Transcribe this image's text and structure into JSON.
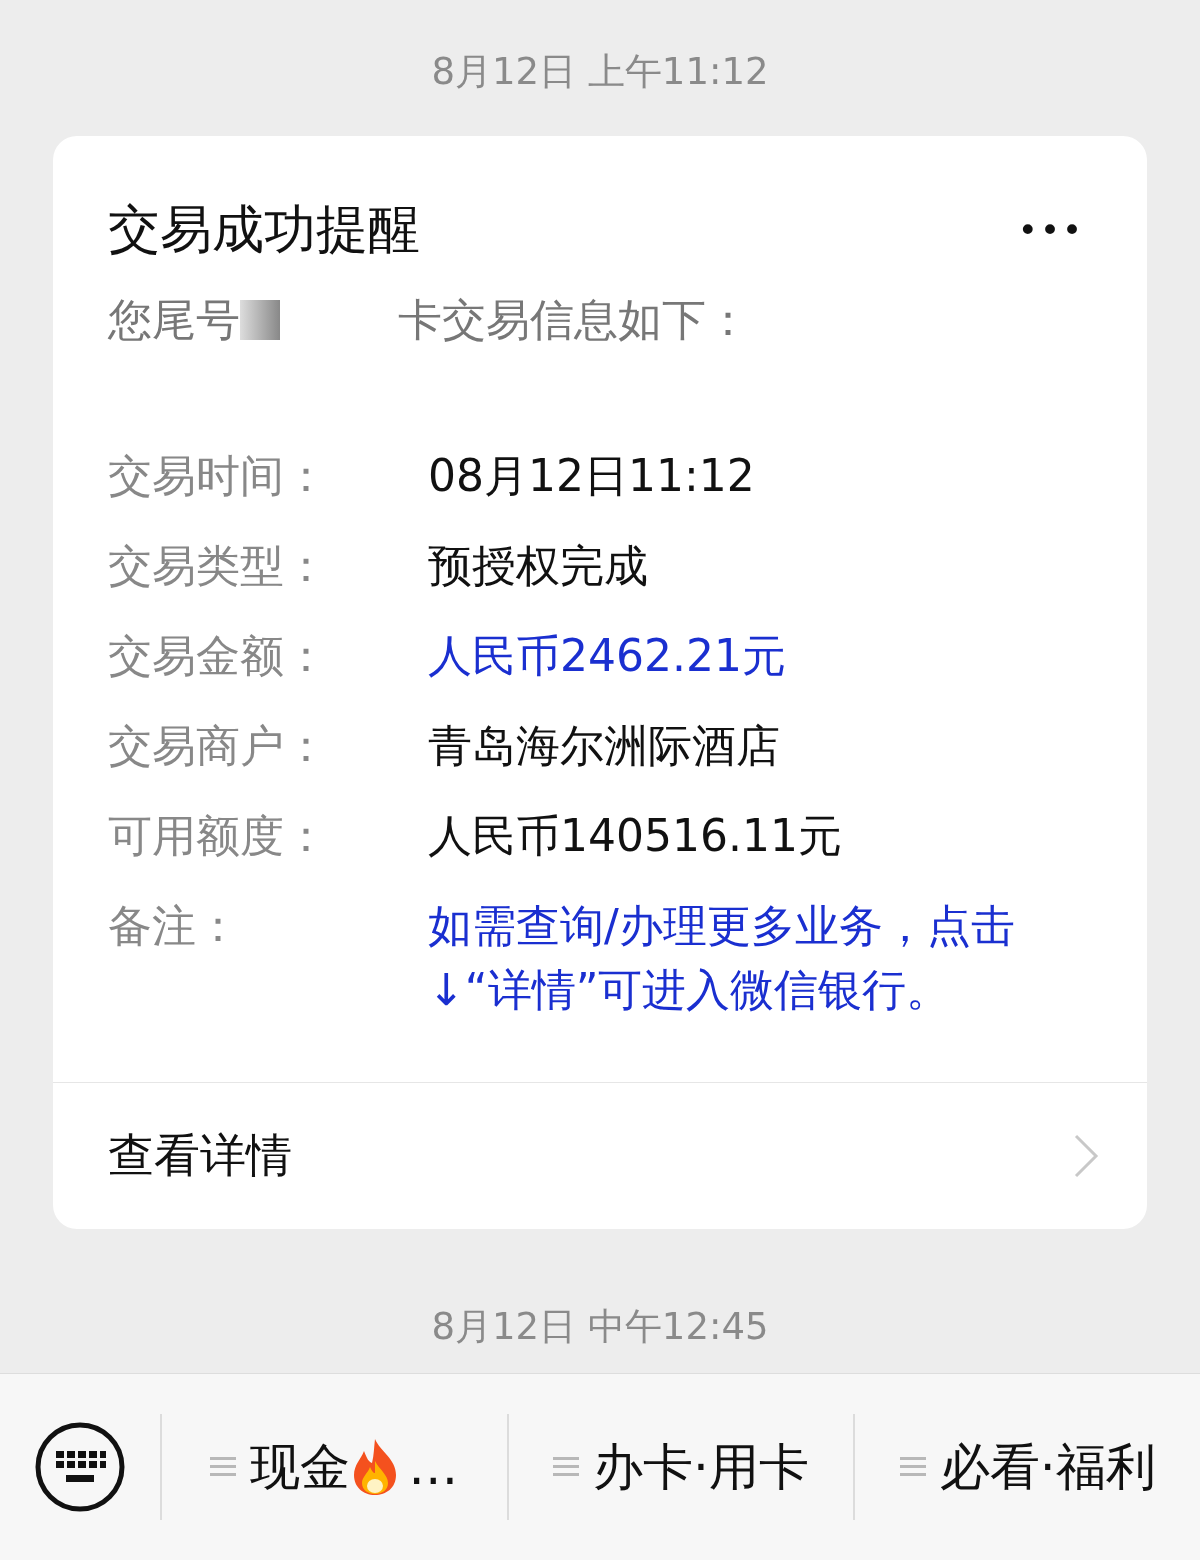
{
  "timestamps": [
    "8月12日 上午11:12",
    "8月12日 中午12:45"
  ],
  "card": {
    "title": "交易成功提醒",
    "more": "•••",
    "intro_before": "您尾号",
    "intro_after": "卡交易信息如下：",
    "rows": [
      {
        "label": "交易时间：",
        "value": "08月12日11:12",
        "highlight": false
      },
      {
        "label": "交易类型：",
        "value": "预授权完成",
        "highlight": false
      },
      {
        "label": "交易金额：",
        "value": "人民币2462.21元",
        "highlight": true
      },
      {
        "label": "交易商户：",
        "value": "青岛海尔洲际酒店",
        "highlight": false
      },
      {
        "label": "可用额度：",
        "value": "人民币140516.11元",
        "highlight": false
      },
      {
        "label": "备注：",
        "value": "如需查询/办理更多业务，点击↓“详情”可进入微信银行。",
        "highlight": true
      }
    ],
    "footer": "查看详情"
  },
  "menu": [
    {
      "label": "现金",
      "kind": "flame",
      "suffix": "…"
    },
    {
      "label": "办卡·用卡",
      "kind": "plain"
    },
    {
      "label": "必看·福利",
      "kind": "plain"
    }
  ]
}
